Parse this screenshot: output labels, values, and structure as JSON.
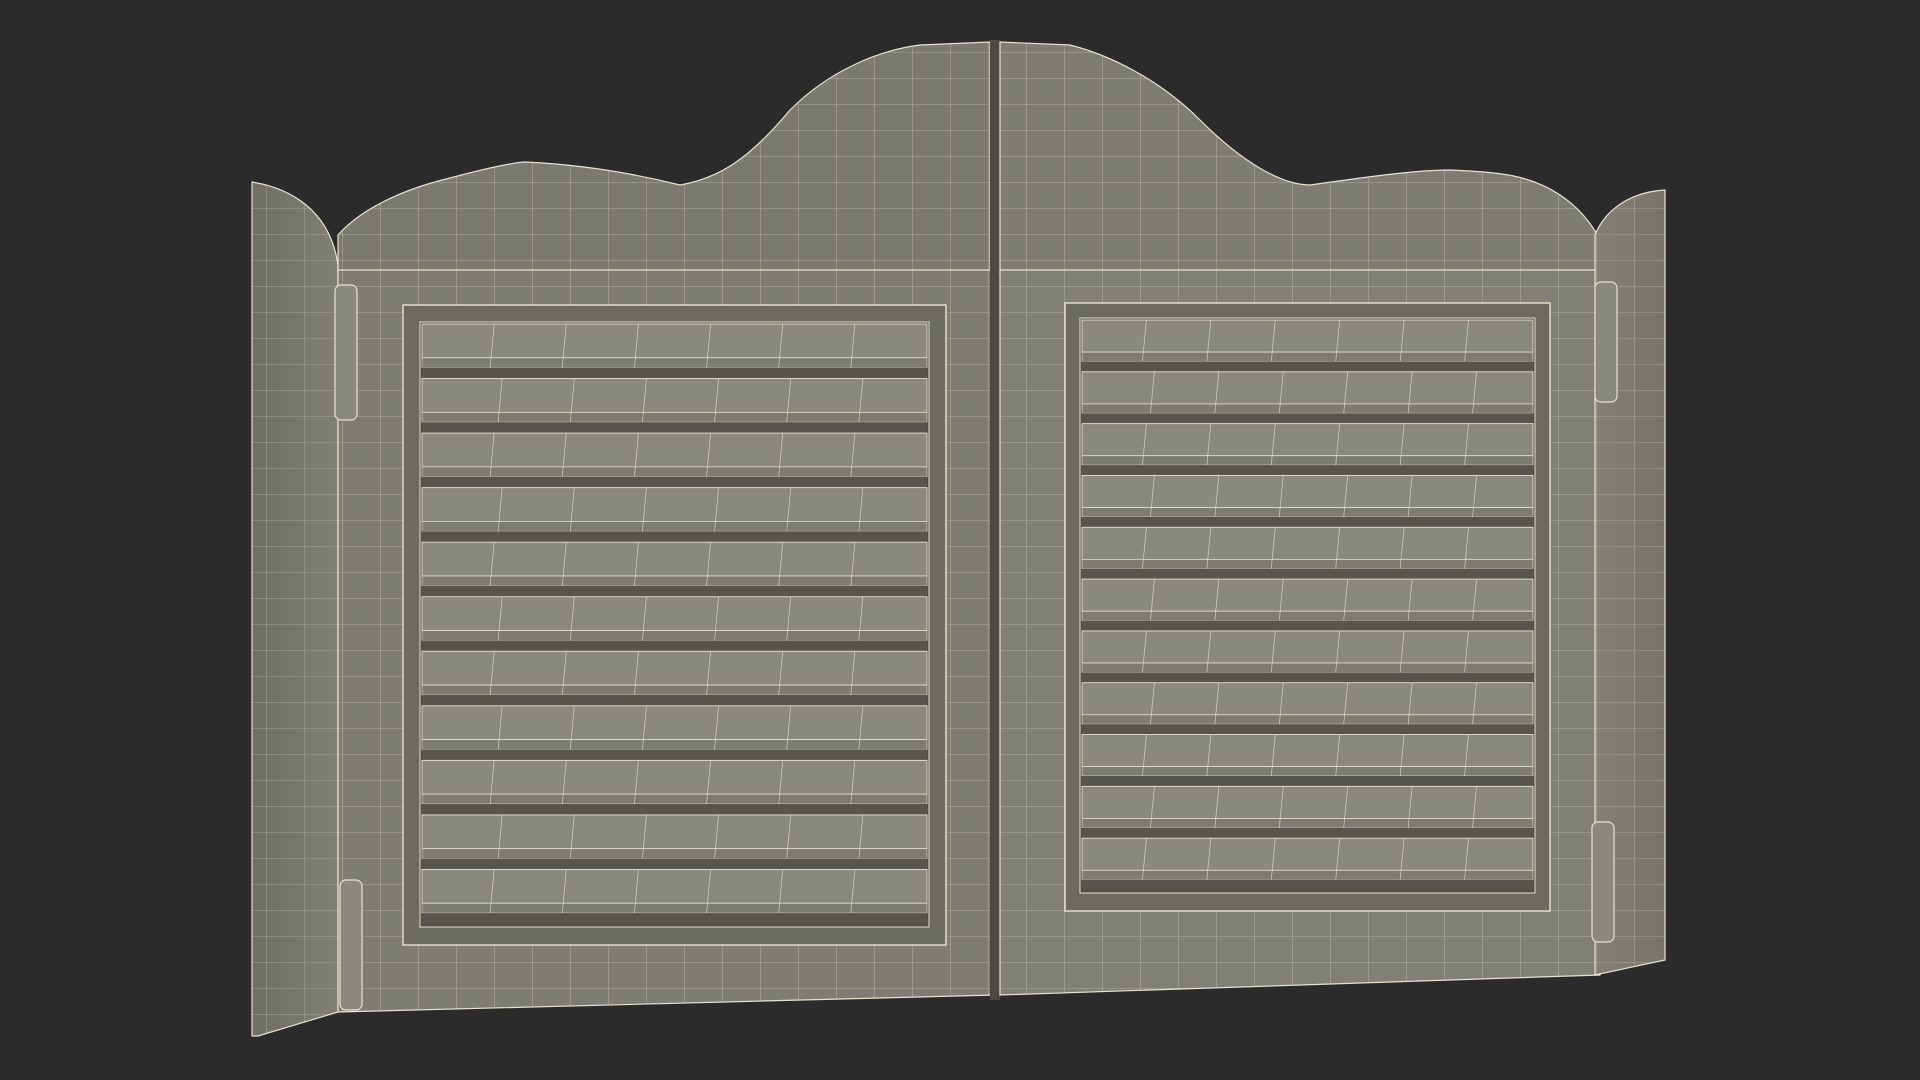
{
  "scene": {
    "subject": "saloon-doors-wireframe",
    "colors": {
      "background": "#2b2b2b",
      "surface": "#7d7c72",
      "surface_dark": "#5f5e56",
      "slat_face": "#8a897f",
      "slat_shadow": "#56554e",
      "wire": "#e6e3cf"
    },
    "doors": [
      {
        "side": "left",
        "hinges": 2,
        "louver_slats": 11
      },
      {
        "side": "right",
        "hinges": 2,
        "louver_slats": 11
      }
    ]
  }
}
